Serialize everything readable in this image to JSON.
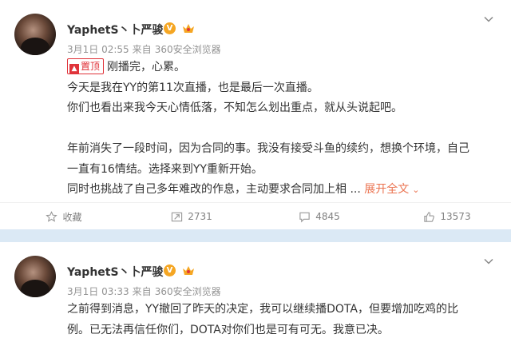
{
  "posts": [
    {
      "username": "YaphetS丶卜严骏",
      "date": "3月1日 02:55",
      "source_prefix": "来自",
      "source": "360安全浏览器",
      "pin_label": "置顶",
      "lines": [
        "刚播完，心累。",
        "今天是我在YY的第11次直播，也是最后一次直播。",
        "你们也看出来我今天心情低落，不知怎么划出重点，就从头说起吧。",
        "",
        "年前消失了一段时间，因为合同的事。我没有接受斗鱼的续约，想换个环境，自己",
        "一直有16情结。选择来到YY重新开始。",
        "同时也挑战了自己多年难改的作息，主动要求合同加上相 ..."
      ],
      "expand_label": "展开全文",
      "actions": {
        "favorite": "收藏",
        "repost": "2731",
        "comment": "4845",
        "like": "13573"
      }
    },
    {
      "username": "YaphetS丶卜严骏",
      "date": "3月1日 03:33",
      "source_prefix": "来自",
      "source": "360安全浏览器",
      "lines": [
        "之前得到消息，YY撤回了昨天的决定，我可以继续播DOTA，但要增加吃鸡的比",
        "例。已无法再信任你们，DOTA对你们也是可有可无。我意已决。"
      ]
    }
  ],
  "colors": {
    "verified": "#f5a623",
    "pin": "#e0333a",
    "expand": "#eb7350",
    "separator": "#dbe9f5"
  }
}
